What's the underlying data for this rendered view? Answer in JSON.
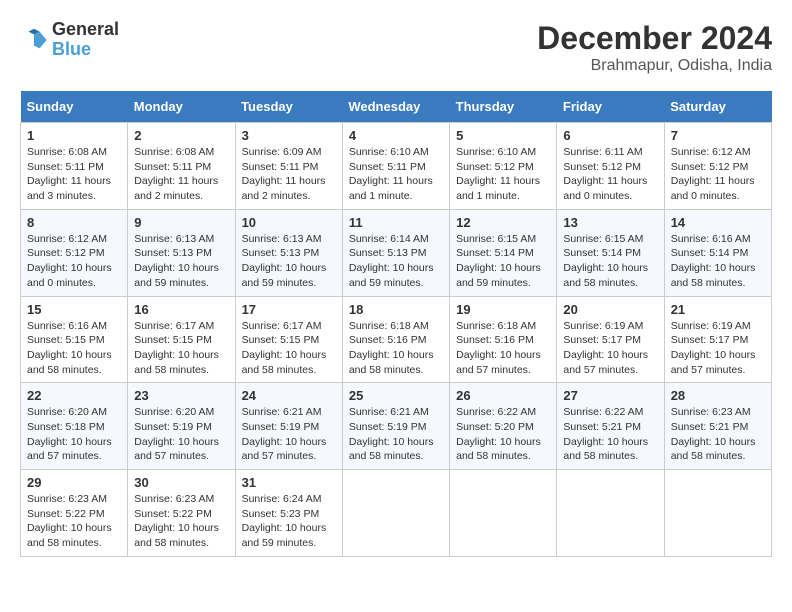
{
  "header": {
    "logo_line1": "General",
    "logo_line2": "Blue",
    "month": "December 2024",
    "location": "Brahmapur, Odisha, India"
  },
  "weekdays": [
    "Sunday",
    "Monday",
    "Tuesday",
    "Wednesday",
    "Thursday",
    "Friday",
    "Saturday"
  ],
  "weeks": [
    [
      {
        "day": 1,
        "sunrise": "6:08 AM",
        "sunset": "5:11 PM",
        "daylight": "11 hours and 3 minutes."
      },
      {
        "day": 2,
        "sunrise": "6:08 AM",
        "sunset": "5:11 PM",
        "daylight": "11 hours and 2 minutes."
      },
      {
        "day": 3,
        "sunrise": "6:09 AM",
        "sunset": "5:11 PM",
        "daylight": "11 hours and 2 minutes."
      },
      {
        "day": 4,
        "sunrise": "6:10 AM",
        "sunset": "5:11 PM",
        "daylight": "11 hours and 1 minute."
      },
      {
        "day": 5,
        "sunrise": "6:10 AM",
        "sunset": "5:12 PM",
        "daylight": "11 hours and 1 minute."
      },
      {
        "day": 6,
        "sunrise": "6:11 AM",
        "sunset": "5:12 PM",
        "daylight": "11 hours and 0 minutes."
      },
      {
        "day": 7,
        "sunrise": "6:12 AM",
        "sunset": "5:12 PM",
        "daylight": "11 hours and 0 minutes."
      }
    ],
    [
      {
        "day": 8,
        "sunrise": "6:12 AM",
        "sunset": "5:12 PM",
        "daylight": "10 hours and 0 minutes."
      },
      {
        "day": 9,
        "sunrise": "6:13 AM",
        "sunset": "5:13 PM",
        "daylight": "10 hours and 59 minutes."
      },
      {
        "day": 10,
        "sunrise": "6:13 AM",
        "sunset": "5:13 PM",
        "daylight": "10 hours and 59 minutes."
      },
      {
        "day": 11,
        "sunrise": "6:14 AM",
        "sunset": "5:13 PM",
        "daylight": "10 hours and 59 minutes."
      },
      {
        "day": 12,
        "sunrise": "6:15 AM",
        "sunset": "5:14 PM",
        "daylight": "10 hours and 59 minutes."
      },
      {
        "day": 13,
        "sunrise": "6:15 AM",
        "sunset": "5:14 PM",
        "daylight": "10 hours and 58 minutes."
      },
      {
        "day": 14,
        "sunrise": "6:16 AM",
        "sunset": "5:14 PM",
        "daylight": "10 hours and 58 minutes."
      }
    ],
    [
      {
        "day": 15,
        "sunrise": "6:16 AM",
        "sunset": "5:15 PM",
        "daylight": "10 hours and 58 minutes."
      },
      {
        "day": 16,
        "sunrise": "6:17 AM",
        "sunset": "5:15 PM",
        "daylight": "10 hours and 58 minutes."
      },
      {
        "day": 17,
        "sunrise": "6:17 AM",
        "sunset": "5:15 PM",
        "daylight": "10 hours and 58 minutes."
      },
      {
        "day": 18,
        "sunrise": "6:18 AM",
        "sunset": "5:16 PM",
        "daylight": "10 hours and 58 minutes."
      },
      {
        "day": 19,
        "sunrise": "6:18 AM",
        "sunset": "5:16 PM",
        "daylight": "10 hours and 57 minutes."
      },
      {
        "day": 20,
        "sunrise": "6:19 AM",
        "sunset": "5:17 PM",
        "daylight": "10 hours and 57 minutes."
      },
      {
        "day": 21,
        "sunrise": "6:19 AM",
        "sunset": "5:17 PM",
        "daylight": "10 hours and 57 minutes."
      }
    ],
    [
      {
        "day": 22,
        "sunrise": "6:20 AM",
        "sunset": "5:18 PM",
        "daylight": "10 hours and 57 minutes."
      },
      {
        "day": 23,
        "sunrise": "6:20 AM",
        "sunset": "5:19 PM",
        "daylight": "10 hours and 57 minutes."
      },
      {
        "day": 24,
        "sunrise": "6:21 AM",
        "sunset": "5:19 PM",
        "daylight": "10 hours and 57 minutes."
      },
      {
        "day": 25,
        "sunrise": "6:21 AM",
        "sunset": "5:19 PM",
        "daylight": "10 hours and 58 minutes."
      },
      {
        "day": 26,
        "sunrise": "6:22 AM",
        "sunset": "5:20 PM",
        "daylight": "10 hours and 58 minutes."
      },
      {
        "day": 27,
        "sunrise": "6:22 AM",
        "sunset": "5:21 PM",
        "daylight": "10 hours and 58 minutes."
      },
      {
        "day": 28,
        "sunrise": "6:23 AM",
        "sunset": "5:21 PM",
        "daylight": "10 hours and 58 minutes."
      }
    ],
    [
      {
        "day": 29,
        "sunrise": "6:23 AM",
        "sunset": "5:22 PM",
        "daylight": "10 hours and 58 minutes."
      },
      {
        "day": 30,
        "sunrise": "6:23 AM",
        "sunset": "5:22 PM",
        "daylight": "10 hours and 58 minutes."
      },
      {
        "day": 31,
        "sunrise": "6:24 AM",
        "sunset": "5:23 PM",
        "daylight": "10 hours and 59 minutes."
      },
      null,
      null,
      null,
      null
    ]
  ]
}
